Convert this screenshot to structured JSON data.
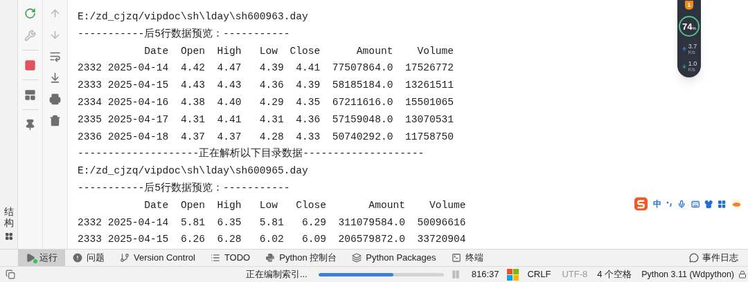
{
  "left_stripe": {
    "tab": "结构"
  },
  "run_toolbar": [
    {
      "kind": "rerun",
      "disabled": false
    },
    {
      "kind": "settings",
      "disabled": true
    },
    {
      "kind": "stop",
      "disabled": false
    },
    {
      "kind": "layout",
      "disabled": false
    },
    {
      "kind": "pin",
      "disabled": false
    }
  ],
  "console_toolbar": [
    {
      "kind": "up",
      "disabled": true
    },
    {
      "kind": "down",
      "disabled": true
    },
    {
      "kind": "wrap",
      "disabled": false
    },
    {
      "kind": "scroll-end",
      "disabled": false
    },
    {
      "kind": "print",
      "disabled": false
    },
    {
      "kind": "clear",
      "disabled": false
    }
  ],
  "console": {
    "lines": [
      "E:/zd_cjzq/vipdoc\\sh\\lday\\sh600963.day",
      "-----------后5行数据预览：-----------",
      "           Date  Open  High   Low  Close      Amount    Volume",
      "2332 2025-04-14  4.42  4.47   4.39  4.41  77507864.0  17526772",
      "2333 2025-04-15  4.43  4.43   4.36  4.39  58185184.0  13261511",
      "2334 2025-04-16  4.38  4.40   4.29  4.35  67211616.0  15501065",
      "2335 2025-04-17  4.31  4.41   4.31  4.36  57159048.0  13070531",
      "2336 2025-04-18  4.37  4.37   4.28  4.33  50740292.0  11758750",
      "--------------------正在解析以下目录数据--------------------",
      "E:/zd_cjzq/vipdoc\\sh\\lday\\sh600965.day",
      "-----------后5行数据预览：-----------",
      "           Date  Open  High   Low   Close       Amount    Volume",
      "2332 2025-04-14  5.81  6.35   5.81   6.29  311079584.0  50096616",
      "2333 2025-04-15  6.26  6.28   6.02   6.09  206579872.0  33720904"
    ]
  },
  "speed_widget": {
    "badge": "1",
    "percent": "74",
    "unit": "%",
    "upload": "3.7",
    "upload_unit": "K/s",
    "download": "1.0",
    "download_unit": "K/s"
  },
  "ime_bar": {
    "mode": "中"
  },
  "tool_tabs": [
    {
      "kind": "run",
      "label": "运行",
      "selected": true
    },
    {
      "kind": "problems",
      "label": "问题",
      "selected": false
    },
    {
      "kind": "vcs",
      "label": "Version Control",
      "selected": false
    },
    {
      "kind": "todo",
      "label": "TODO",
      "selected": false
    },
    {
      "kind": "python",
      "label": "Python 控制台",
      "selected": false
    },
    {
      "kind": "packages",
      "label": "Python Packages",
      "selected": false
    },
    {
      "kind": "terminal",
      "label": "终端",
      "selected": false
    }
  ],
  "event_log": "事件日志",
  "status_bar": {
    "task": "正在编制索引...",
    "progress": {
      "level": 0.6
    },
    "position": "816:37",
    "line_ending": "CRLF",
    "encoding": "UTF-8",
    "indent": "4 个空格",
    "interpreter": "Python 3.11 (Wdpython)"
  }
}
